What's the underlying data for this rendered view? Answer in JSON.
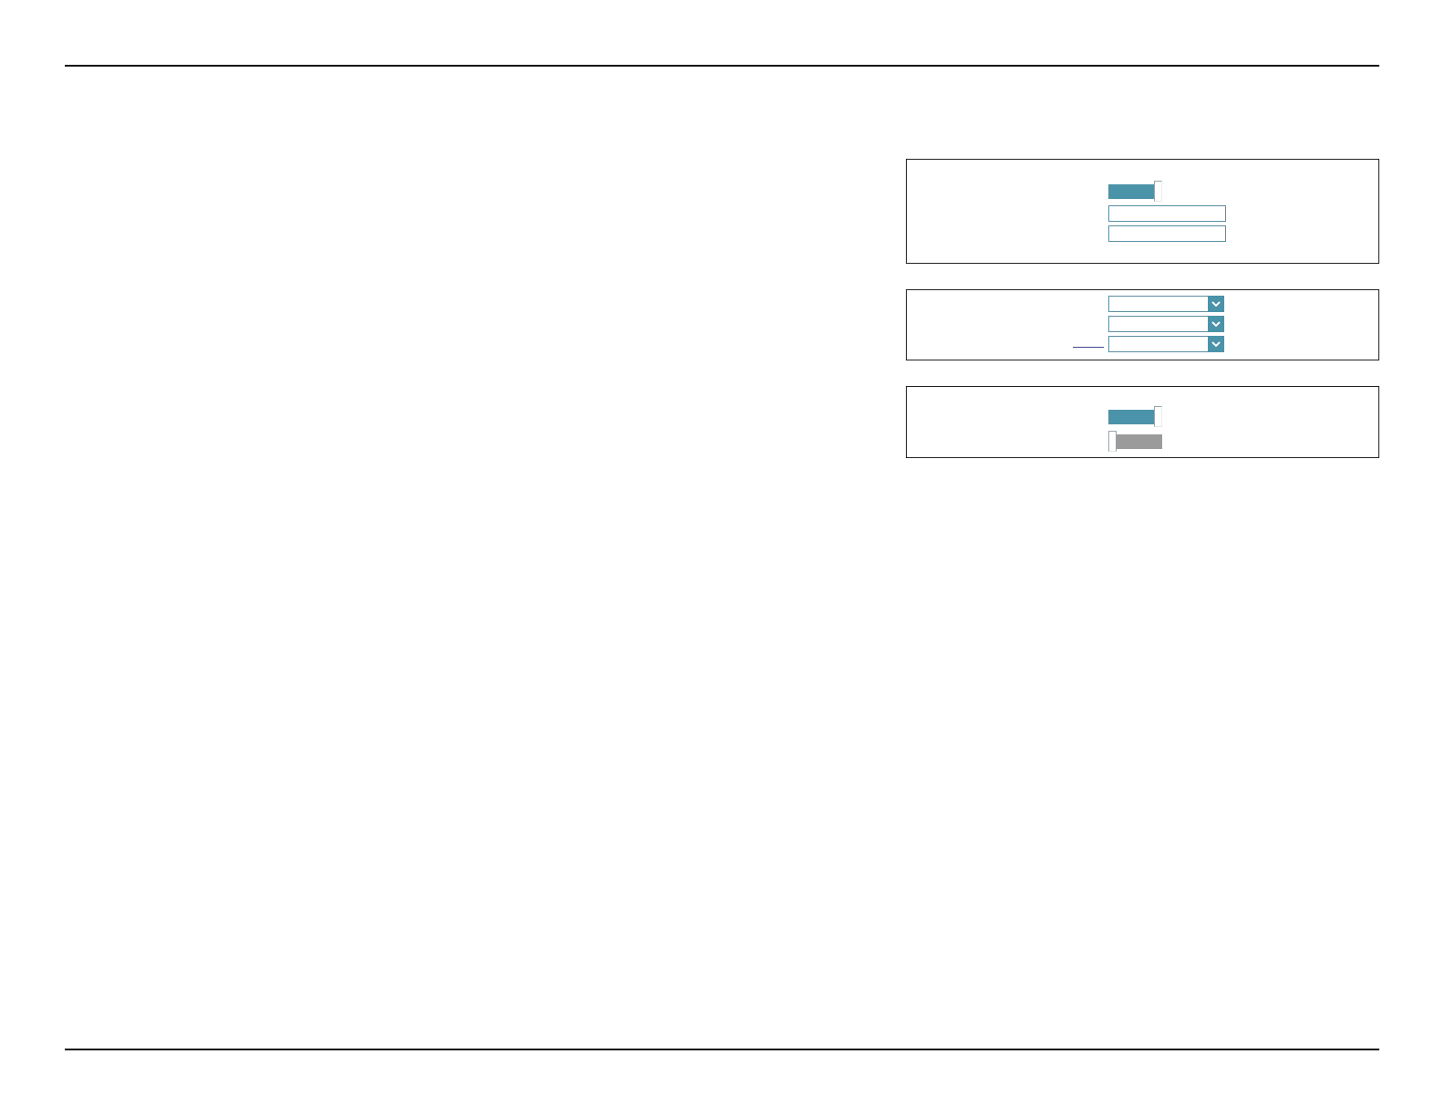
{
  "panels": [
    {
      "rows": [
        {
          "kind": "toggle",
          "on": true
        },
        {
          "kind": "input"
        },
        {
          "kind": "input"
        }
      ]
    },
    {
      "rows": [
        {
          "kind": "select"
        },
        {
          "kind": "select"
        },
        {
          "kind": "select",
          "underline": true
        }
      ]
    },
    {
      "rows": [
        {
          "kind": "toggle",
          "on": true
        },
        {
          "kind": "toggle",
          "on": false
        }
      ]
    }
  ]
}
